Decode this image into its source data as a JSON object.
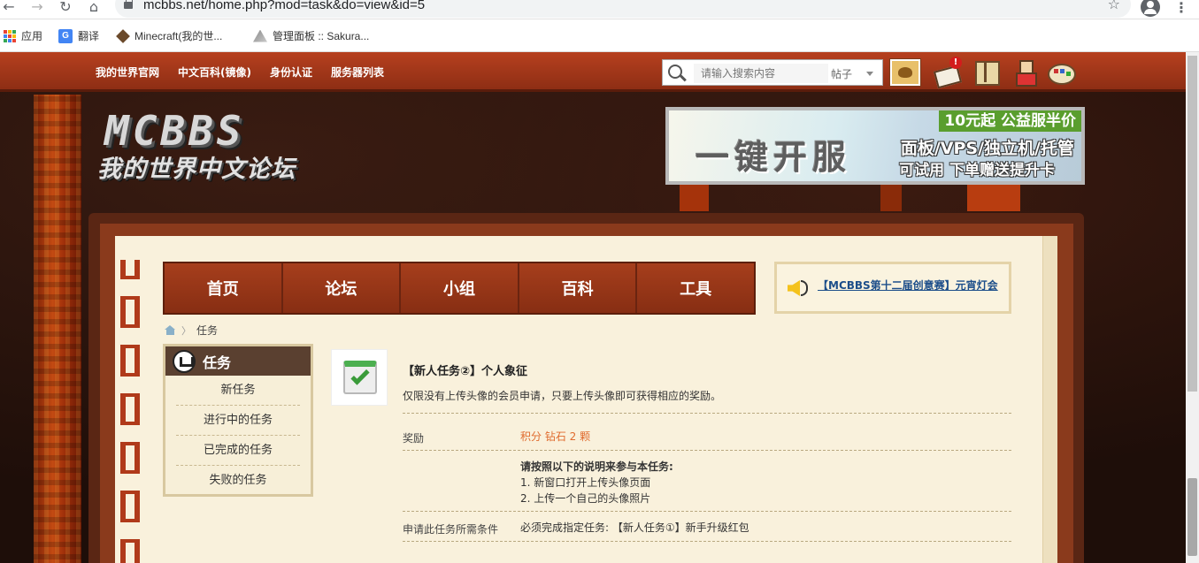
{
  "browser": {
    "url": "mcbbs.net/home.php?mod=task&do=view&id=5",
    "bookmarks": [
      "应用",
      "翻译",
      "Minecraft(我的世...",
      "管理面板 :: Sakura..."
    ]
  },
  "topbar": {
    "links": [
      "我的世界官网",
      "中文百科(镜像)",
      "身份认证",
      "服务器列表"
    ],
    "search_placeholder": "请输入搜索内容",
    "search_scope": "帖子",
    "notification_count": "!"
  },
  "logo": {
    "main": "MCBBS",
    "sub": "我的世界中文论坛"
  },
  "banner": {
    "tag": "10元起 公益服半价",
    "big": "一键开服",
    "line1": "面板/VPS/独立机/托管",
    "line2": "可试用 下单赠送提升卡"
  },
  "mainnav": [
    "首页",
    "论坛",
    "小组",
    "百科",
    "工具"
  ],
  "notice": "【MCBBS第十二届创意赛】元宵灯会",
  "breadcrumb": {
    "current": "任务"
  },
  "sidebar": {
    "title": "任务",
    "items": [
      "新任务",
      "进行中的任务",
      "已完成的任务",
      "失败的任务"
    ]
  },
  "task": {
    "title": "【新人任务②】个人象征",
    "desc": "仅限没有上传头像的会员申请，只要上传头像即可获得相应的奖励。",
    "reward_label": "奖励",
    "reward_value": "积分 钻石 2 颗",
    "instructions_title": "请按照以下的说明来参与本任务:",
    "steps": [
      "1. 新窗口打开上传头像页面",
      "2. 上传一个自己的头像照片"
    ],
    "prereq_label": "申请此任务所需条件",
    "prereq_value": "必须完成指定任务: 【新人任务①】新手升级红包"
  },
  "colors": {
    "topbar": "#a63e1c",
    "nav": "#8f3316",
    "paper": "#f9f1dc",
    "reward": "#e06b2e",
    "notice_link": "#1c4e8a"
  }
}
